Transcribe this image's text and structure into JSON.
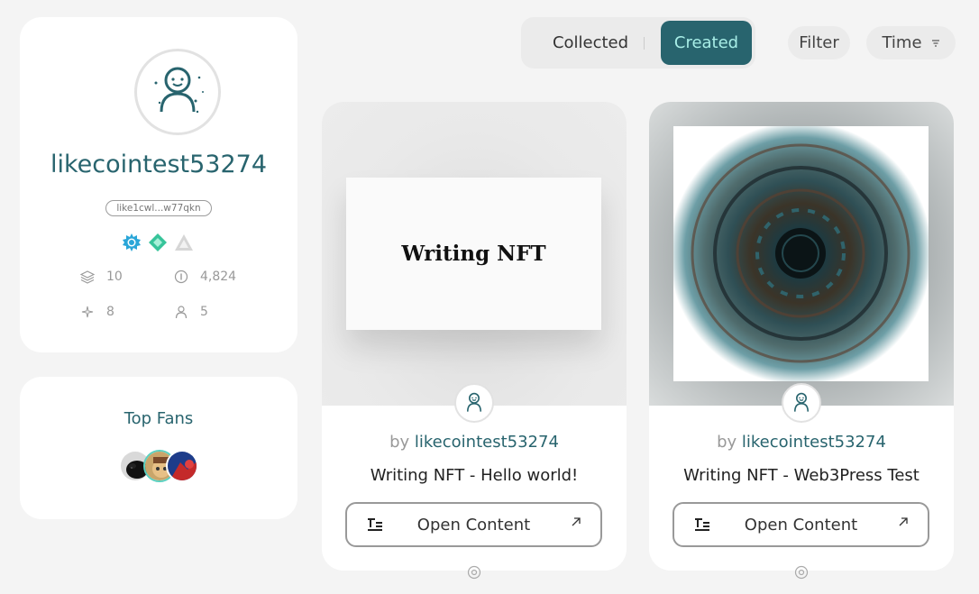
{
  "profile": {
    "username": "likecointest53274",
    "wallet": "like1cwl...w77qkn",
    "badges": [
      "sun-badge-icon",
      "diamond-badge-icon",
      "triangle-badge-icon"
    ],
    "stats": {
      "collections": "10",
      "value": "4,824",
      "stars": "8",
      "followers": "5"
    },
    "colors": {
      "accent": "#28646e",
      "accent_light": "#a8eee7"
    }
  },
  "fans": {
    "title": "Top Fans"
  },
  "tabs": {
    "collected": "Collected",
    "created": "Created",
    "active": "created"
  },
  "controls": {
    "filter": "Filter",
    "time": "Time"
  },
  "nfts": [
    {
      "preview_text": "Writing NFT",
      "by_prefix": "by",
      "owner": "likecointest53274",
      "title": "Writing NFT - Hello world!",
      "button": "Open Content"
    },
    {
      "by_prefix": "by",
      "owner": "likecointest53274",
      "title": "Writing NFT - Web3Press Test",
      "button": "Open Content"
    }
  ]
}
